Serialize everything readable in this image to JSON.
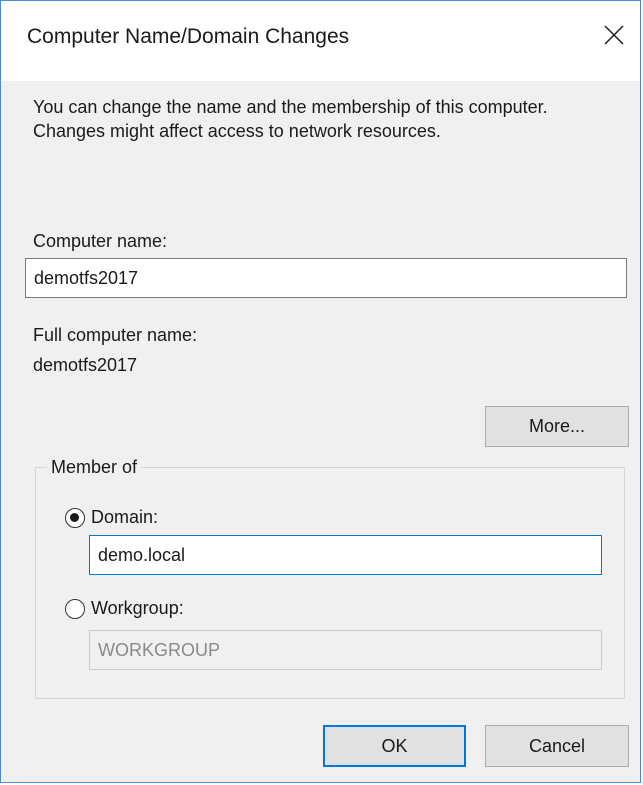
{
  "window": {
    "title": "Computer Name/Domain Changes",
    "close_icon": "close-icon"
  },
  "description": "You can change the name and the membership of this computer. Changes might affect access to network resources.",
  "computer_name": {
    "label": "Computer name:",
    "value": "demotfs2017"
  },
  "full_computer_name": {
    "label": "Full computer name:",
    "value": "demotfs2017"
  },
  "more_button": {
    "label": "More..."
  },
  "member_of": {
    "legend": "Member of",
    "domain": {
      "label": "Domain:",
      "selected": true,
      "value": "demo.local"
    },
    "workgroup": {
      "label": "Workgroup:",
      "selected": false,
      "value": "WORKGROUP"
    }
  },
  "buttons": {
    "ok": "OK",
    "cancel": "Cancel"
  },
  "colors": {
    "accent": "#0078d7",
    "window_border": "#4a8ad8",
    "dialog_background": "#f0f0f0"
  }
}
